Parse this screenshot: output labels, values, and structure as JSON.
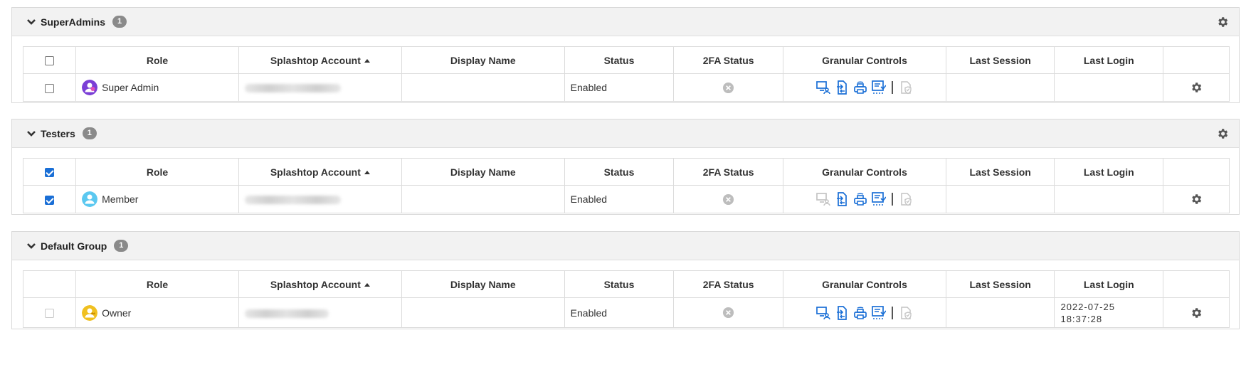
{
  "columns": {
    "role": "Role",
    "account": "Splashtop Account",
    "display_name": "Display Name",
    "status": "Status",
    "twofa": "2FA Status",
    "granular": "Granular Controls",
    "last_session": "Last Session",
    "last_login": "Last Login"
  },
  "groups": [
    {
      "name": "SuperAdmins",
      "count": "1",
      "header_checked": false,
      "row": {
        "checked": false,
        "role": "Super Admin",
        "avatar_color": "#7b3fd6",
        "display_name": "",
        "status": "Enabled",
        "last_session": "",
        "last_login": "",
        "granular": [
          "remote-access-icon",
          "file-transfer-icon",
          "remote-print-icon",
          "session-recording-icon",
          "security-shield-icon"
        ]
      }
    },
    {
      "name": "Testers",
      "count": "1",
      "header_checked": true,
      "row": {
        "checked": true,
        "role": "Member",
        "avatar_color": "#5bc8f0",
        "display_name": "",
        "status": "Enabled",
        "last_session": "",
        "last_login": "",
        "granular": [
          "remote-access-icon",
          "file-transfer-icon",
          "remote-print-icon",
          "session-recording-icon",
          "security-shield-icon"
        ]
      }
    },
    {
      "name": "Default Group",
      "count": "1",
      "header_checked": null,
      "row": {
        "checked": false,
        "role": "Owner",
        "avatar_color": "#f0c020",
        "display_name": "",
        "status": "Enabled",
        "last_session": "",
        "last_login": "2022-07-25\n18:37:28",
        "granular": [
          "remote-access-icon",
          "file-transfer-icon",
          "remote-print-icon",
          "session-recording-icon",
          "security-shield-icon"
        ]
      }
    }
  ],
  "colors": {
    "accent_blue": "#1a6fd6",
    "disabled_gray": "#c4c4c4",
    "badge_gray": "#8a8a8a"
  }
}
